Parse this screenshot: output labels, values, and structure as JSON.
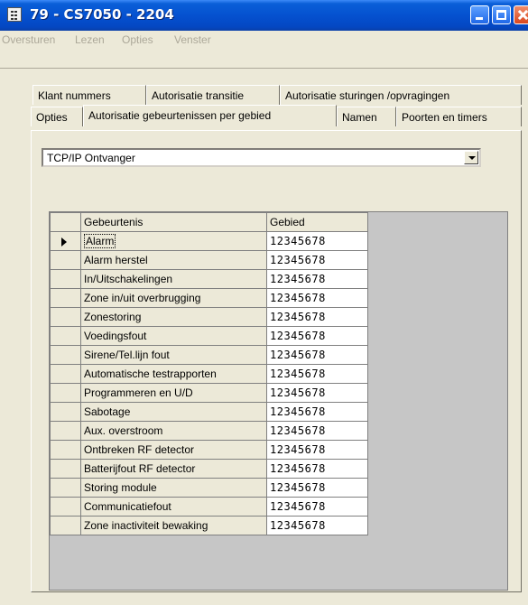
{
  "window": {
    "title": "79 - CS7050 - 2204"
  },
  "menu": [
    "Oversturen",
    "Lezen",
    "Opties",
    "Venster"
  ],
  "tabs_row1": [
    "Klant nummers",
    "Autorisatie transitie",
    "Autorisatie sturingen /opvragingen"
  ],
  "tabs_row2": [
    "Opties",
    "Autorisatie gebeurtenissen per gebied",
    "Namen",
    "Poorten en timers"
  ],
  "active_tab": "Autorisatie gebeurtenissen per gebied",
  "receiver_select": {
    "value": "TCP/IP Ontvanger"
  },
  "grid": {
    "headers": [
      "Gebeurtenis",
      "Gebied"
    ],
    "rows": [
      {
        "event": "Alarm",
        "areas": "12345678"
      },
      {
        "event": "Alarm herstel",
        "areas": "12345678"
      },
      {
        "event": "In/Uitschakelingen",
        "areas": "12345678"
      },
      {
        "event": "Zone in/uit overbrugging",
        "areas": "12345678"
      },
      {
        "event": "Zonestoring",
        "areas": "12345678"
      },
      {
        "event": "Voedingsfout",
        "areas": "12345678"
      },
      {
        "event": "Sirene/Tel.lijn fout",
        "areas": "12345678"
      },
      {
        "event": "Automatische testrapporten",
        "areas": "12345678"
      },
      {
        "event": "Programmeren en U/D",
        "areas": "12345678"
      },
      {
        "event": "Sabotage",
        "areas": "12345678"
      },
      {
        "event": "Aux. overstroom",
        "areas": "12345678"
      },
      {
        "event": "Ontbreken RF detector",
        "areas": "12345678"
      },
      {
        "event": "Batterijfout RF detector",
        "areas": "12345678"
      },
      {
        "event": "Storing module",
        "areas": "12345678"
      },
      {
        "event": "Communicatiefout",
        "areas": "12345678"
      },
      {
        "event": "Zone inactiviteit bewaking",
        "areas": "12345678"
      }
    ]
  }
}
